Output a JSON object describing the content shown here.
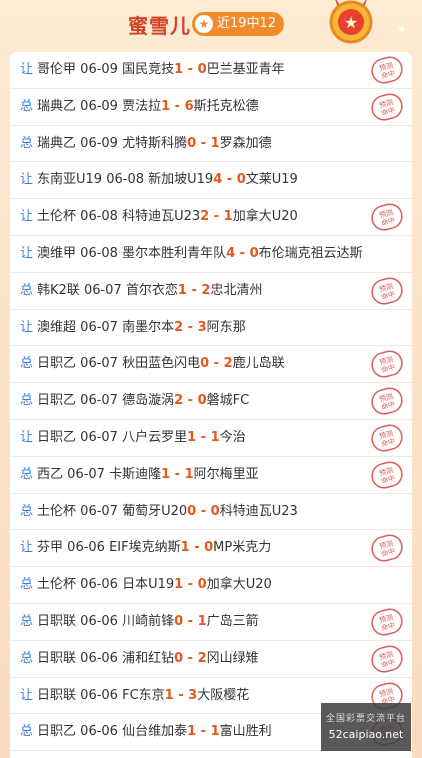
{
  "header": {
    "title": "蜜雪儿",
    "record": "近19中12",
    "accent": "#f08a2a",
    "title_color": "#d2442a"
  },
  "stamp_label": "预测命中",
  "rows": [
    {
      "tag": "让",
      "league": "哥伦甲",
      "date": "06-09",
      "home": "国民竞技",
      "home_score": "1",
      "sep": " - ",
      "away_score": "0",
      "away": "巴兰基亚青年",
      "hit": true
    },
    {
      "tag": "总",
      "league": "瑞典乙",
      "date": "06-09",
      "home": "贾法拉",
      "home_score": "1",
      "sep": " - ",
      "away_score": "6",
      "away": "斯托克松德",
      "hit": true
    },
    {
      "tag": "总",
      "league": "瑞典乙",
      "date": "06-09",
      "home": "尤特斯科腾",
      "home_score": "0",
      "sep": " - ",
      "away_score": "1",
      "away": "罗森加德",
      "hit": false
    },
    {
      "tag": "让",
      "league": "东南亚U19",
      "date": "06-08",
      "home": "新加坡U19",
      "home_score": "4",
      "sep": " - ",
      "away_score": "0",
      "away": "文莱U19",
      "hit": false
    },
    {
      "tag": "让",
      "league": "土伦杯",
      "date": "06-08",
      "home": "科特迪瓦U23",
      "home_score": "2",
      "sep": " - ",
      "away_score": "1",
      "away": "加拿大U20",
      "hit": true
    },
    {
      "tag": "让",
      "league": "澳维甲",
      "date": "06-08",
      "home": "墨尔本胜利青年队",
      "home_score": "4",
      "sep": " - ",
      "away_score": "0",
      "away": "布伦瑞克祖云达斯",
      "hit": false
    },
    {
      "tag": "总",
      "league": "韩K2联",
      "date": "06-07",
      "home": "首尔衣恋",
      "home_score": "1",
      "sep": " - ",
      "away_score": "2",
      "away": "忠北清州",
      "hit": true
    },
    {
      "tag": "让",
      "league": "澳维超",
      "date": "06-07",
      "home": "南墨尔本",
      "home_score": "2",
      "sep": " - ",
      "away_score": "3",
      "away": "阿东那",
      "hit": false
    },
    {
      "tag": "总",
      "league": "日职乙",
      "date": "06-07",
      "home": "秋田蓝色闪电",
      "home_score": "0",
      "sep": " - ",
      "away_score": "2",
      "away": "鹿儿岛联",
      "hit": true
    },
    {
      "tag": "总",
      "league": "日职乙",
      "date": "06-07",
      "home": "德岛漩涡",
      "home_score": "2",
      "sep": " - ",
      "away_score": "0",
      "away": "磐城FC",
      "hit": true
    },
    {
      "tag": "让",
      "league": "日职乙",
      "date": "06-07",
      "home": "八户云罗里",
      "home_score": "1",
      "sep": " - ",
      "away_score": "1",
      "away": "今治",
      "hit": true
    },
    {
      "tag": "总",
      "league": "西乙",
      "date": "06-07",
      "home": "卡斯迪隆",
      "home_score": "1",
      "sep": " - ",
      "away_score": "1",
      "away": "阿尔梅里亚",
      "hit": true
    },
    {
      "tag": "总",
      "league": "土伦杯",
      "date": "06-07",
      "home": "葡萄牙U20",
      "home_score": "0",
      "sep": " - ",
      "away_score": "0",
      "away": "科特迪瓦U23",
      "hit": false
    },
    {
      "tag": "让",
      "league": "芬甲",
      "date": "06-06",
      "home": "EIF埃克纳斯",
      "home_score": "1",
      "sep": " - ",
      "away_score": "0",
      "away": "MP米克力",
      "hit": true
    },
    {
      "tag": "总",
      "league": "土伦杯",
      "date": "06-06",
      "home": "日本U19",
      "home_score": "1",
      "sep": " - ",
      "away_score": "0",
      "away": "加拿大U20",
      "hit": false
    },
    {
      "tag": "总",
      "league": "日职联",
      "date": "06-06",
      "home": "川崎前锋",
      "home_score": "0",
      "sep": " - ",
      "away_score": "1",
      "away": "广岛三箭",
      "hit": true
    },
    {
      "tag": "总",
      "league": "日职联",
      "date": "06-06",
      "home": "浦和红钻",
      "home_score": "0",
      "sep": " - ",
      "away_score": "2",
      "away": "冈山绿雉",
      "hit": true
    },
    {
      "tag": "让",
      "league": "日职联",
      "date": "06-06",
      "home": "FC东京",
      "home_score": "1",
      "sep": " - ",
      "away_score": "3",
      "away": "大阪樱花",
      "hit": true
    },
    {
      "tag": "总",
      "league": "日职乙",
      "date": "06-06",
      "home": "仙台维加泰",
      "home_score": "1",
      "sep": " - ",
      "away_score": "1",
      "away": "富山胜利",
      "hit": true
    }
  ],
  "watermark": {
    "title": "全国彩票交流平台",
    "url": "52caipiao.net"
  }
}
